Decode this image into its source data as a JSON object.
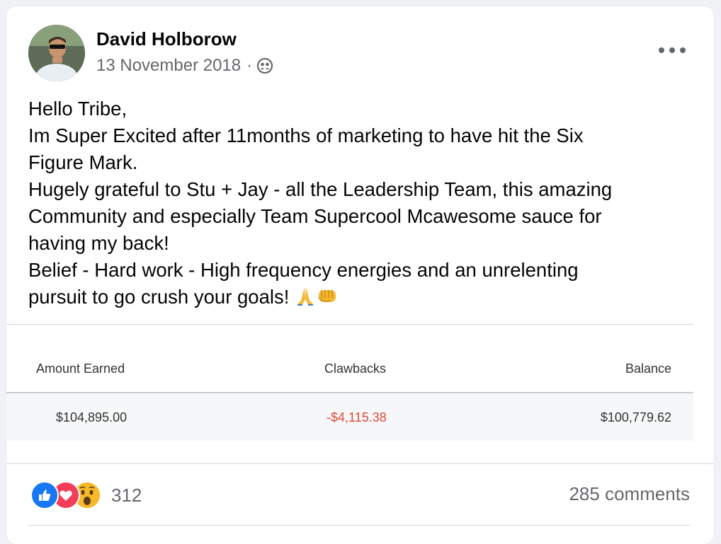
{
  "post": {
    "author": "David Holborow",
    "date": "13 November 2018",
    "separator": "·",
    "audience_icon": "friends-icon",
    "text_lines": [
      "Hello Tribe,",
      "Im Super Excited after 11months of marketing to have hit the Six",
      "Figure Mark.",
      "Hugely grateful to Stu + Jay - all the Leadership Team, this amazing",
      "Community and especially Team Supercool Mcawesome sauce for",
      "having my back!",
      "Belief - Hard work - High frequency energies and an unrelenting",
      "pursuit to go crush your goals!"
    ],
    "emoji_names": [
      "folded-hands-icon",
      "fist-icon"
    ]
  },
  "earnings_table": {
    "headers": [
      "Amount Earned",
      "Clawbacks",
      "Balance"
    ],
    "row": [
      "$104,895.00",
      "-$4,115.38",
      "$100,779.62"
    ],
    "clawback_color": "#e04b3a"
  },
  "engagement": {
    "reaction_icons": [
      "like-icon",
      "love-icon",
      "wow-icon"
    ],
    "reaction_count": "312",
    "comments": "285 comments"
  },
  "colors": {
    "like": "#1877f2",
    "love": "#f33e58",
    "wow": "#f7b928"
  }
}
